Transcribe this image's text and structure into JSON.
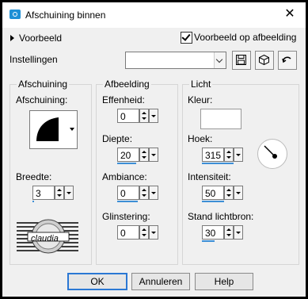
{
  "window": {
    "title": "Afschuining binnen"
  },
  "preview": {
    "expander_label": "Voorbeeld",
    "preview_on_image_label": "Voorbeeld op afbeelding",
    "preview_on_image_checked": true
  },
  "settings": {
    "label": "Instellingen",
    "preset_value": ""
  },
  "groups": {
    "bevel": {
      "title": "Afschuining",
      "shape_label": "Afschuining:",
      "width_label": "Breedte:",
      "width_value": "3"
    },
    "image": {
      "title": "Afbeelding",
      "smoothness_label": "Effenheid:",
      "smoothness_value": "0",
      "depth_label": "Diepte:",
      "depth_value": "20",
      "ambience_label": "Ambiance:",
      "ambience_value": "0",
      "shininess_label": "Glinstering:",
      "shininess_value": "0"
    },
    "light": {
      "title": "Licht",
      "color_label": "Kleur:",
      "color_value": "#ffffff",
      "angle_label": "Hoek:",
      "angle_value": "315",
      "intensity_label": "Intensiteit:",
      "intensity_value": "50",
      "elevation_label": "Stand lichtbron:",
      "elevation_value": "30"
    }
  },
  "logo_text": "claudia",
  "buttons": {
    "ok": "OK",
    "cancel": "Annuleren",
    "help": "Help"
  },
  "icons": {
    "app": "camera-icon",
    "close": "close-icon",
    "save": "save-icon",
    "randomize": "dice-icon",
    "reset": "reset-arrow-icon"
  },
  "colors": {
    "accent": "#2b78d4",
    "slider_fill": "#3d8fd6"
  }
}
